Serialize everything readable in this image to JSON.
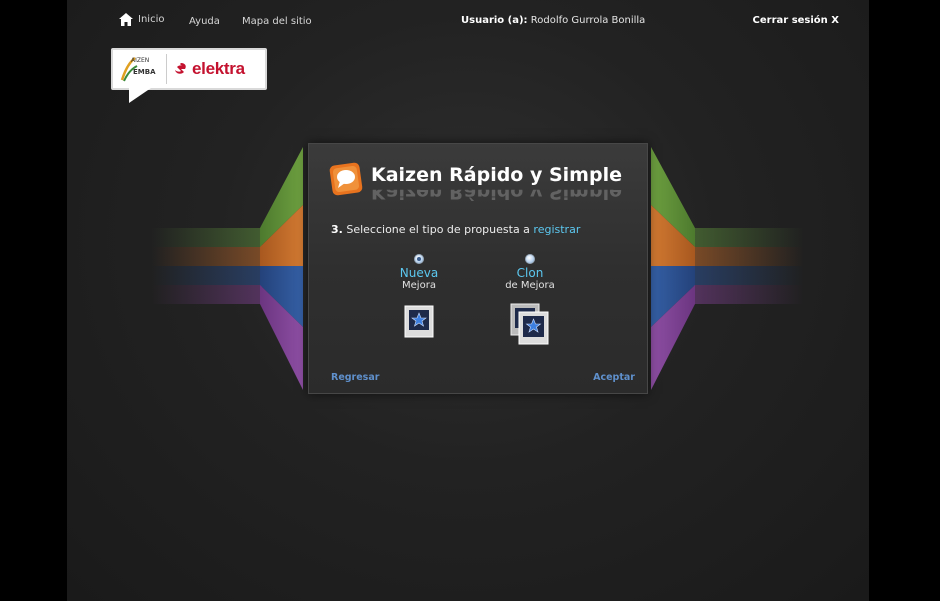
{
  "nav": {
    "inicio": "Inicio",
    "ayuda": "Ayuda",
    "mapa": "Mapa del sitio",
    "usuario_label": "Usuario (a):",
    "usuario_name": "Rodolfo Gurrola Bonilla",
    "cerrar": "Cerrar sesión X"
  },
  "logo": {
    "gemba_top": "AIZEN",
    "gemba_bottom": "EMBA",
    "brand": "elektra"
  },
  "dialog": {
    "title": "Kaizen Rápido y Simple",
    "step_number": "3.",
    "step_text": "Seleccione el tipo de propuesta a",
    "step_highlight": "registrar",
    "options": [
      {
        "name": "Nueva",
        "sub": "Mejora",
        "selected": true
      },
      {
        "name": "Clon",
        "sub": "de Mejora",
        "selected": false
      }
    ],
    "back_label": "Regresar",
    "accept_label": "Aceptar"
  },
  "colors": {
    "accent": "#5cc8f0",
    "link_blue": "#5f90cc",
    "band_green": "#5a8a3a",
    "band_orange": "#c06a2a",
    "band_blue": "#2c4f8c",
    "band_purple": "#7a3f8c",
    "brand_red": "#c4122f"
  }
}
